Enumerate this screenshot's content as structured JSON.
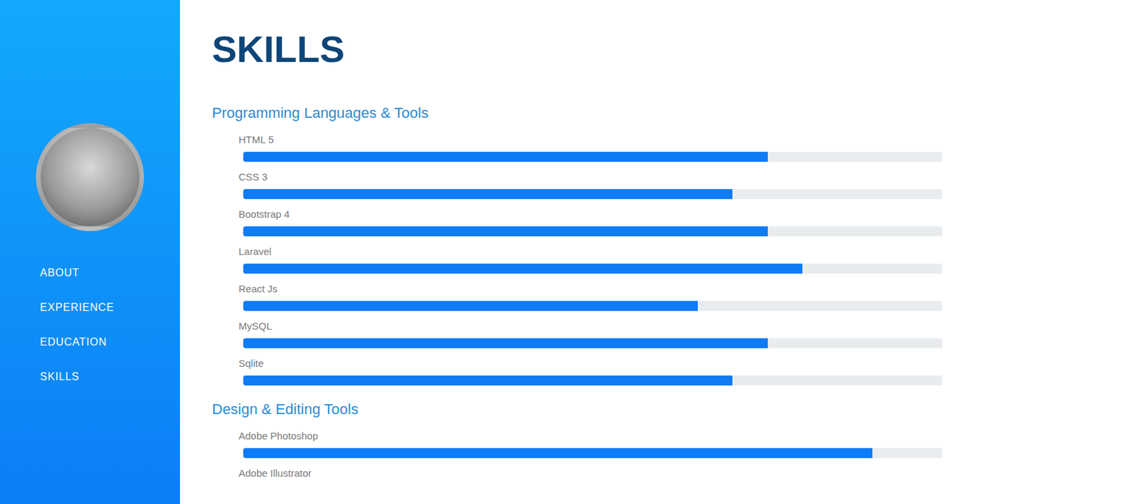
{
  "sidebar": {
    "items": [
      {
        "label": "ABOUT"
      },
      {
        "label": "EXPERIENCE"
      },
      {
        "label": "EDUCATION"
      },
      {
        "label": "SKILLS"
      }
    ]
  },
  "heading": "SKILLS",
  "sections": [
    {
      "title": "Programming Languages & Tools",
      "skills": [
        {
          "name": "HTML 5",
          "level": 0.75
        },
        {
          "name": "CSS 3",
          "level": 0.7
        },
        {
          "name": "Bootstrap 4",
          "level": 0.75
        },
        {
          "name": "Laravel",
          "level": 0.8
        },
        {
          "name": "React Js",
          "level": 0.65
        },
        {
          "name": "MySQL",
          "level": 0.75
        },
        {
          "name": "Sqlite",
          "level": 0.7
        }
      ]
    },
    {
      "title": "Design & Editing Tools",
      "skills": [
        {
          "name": "Adobe Photoshop",
          "level": 0.9
        },
        {
          "name": "Adobe Illustrator"
        }
      ]
    }
  ]
}
